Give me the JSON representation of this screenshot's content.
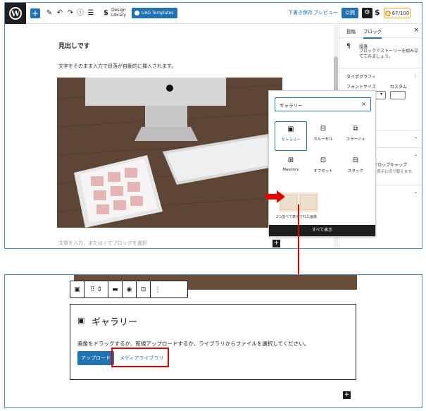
{
  "toolbar": {
    "logo": "W",
    "add_icon": "+",
    "design_library_label": "Design Library",
    "uag_templates_label": "UAG Templates",
    "save_draft_label": "下書き保存",
    "preview_label": "プレビュー",
    "publish_label": "公開",
    "score_label": "67/100"
  },
  "editor": {
    "heading": "見出しです",
    "paragraph": "文字をそのまま入力で段落が自動的に挿入されます。",
    "placeholder": "文章を入力、または / でブロックを選択"
  },
  "sidebar": {
    "tab_post": "投稿",
    "tab_block": "ブロック",
    "close_icon": "×",
    "paragraph_title": "段落",
    "paragraph_desc": "ブロックでストーリーを組み立ててみましょう。",
    "typography": "タイポグラフィ",
    "font_size": "フォントサイズ",
    "custom": "カスタム",
    "drop_cap": "ドロップキャップ",
    "drop_cap_desc": "...表示に切り替えます。"
  },
  "inserter": {
    "search_value": "ギャラリー",
    "clear_icon": "×",
    "items": [
      {
        "label": "ギャラリー",
        "icon": "gallery-icon"
      },
      {
        "label": "カルーセル",
        "icon": "carousel-icon"
      },
      {
        "label": "コラージュ",
        "icon": "collage-icon"
      },
      {
        "label": "Masonry",
        "icon": "masonry-icon"
      },
      {
        "label": "オフセット",
        "icon": "offset-icon"
      },
      {
        "label": "スタック",
        "icon": "stack-icon"
      }
    ],
    "pattern_label": "2つ並べて表示された画像",
    "show_all": "すべて表示"
  },
  "gallery_block": {
    "title": "ギャラリー",
    "instructions": "画像をドラッグするか、新規アップロードするか、ライブラリからファイルを選択してください。",
    "upload_label": "アップロード",
    "media_library_label": "メディアライブラリ"
  },
  "colors": {
    "accent": "#2271b1",
    "highlight": "#e00000"
  }
}
